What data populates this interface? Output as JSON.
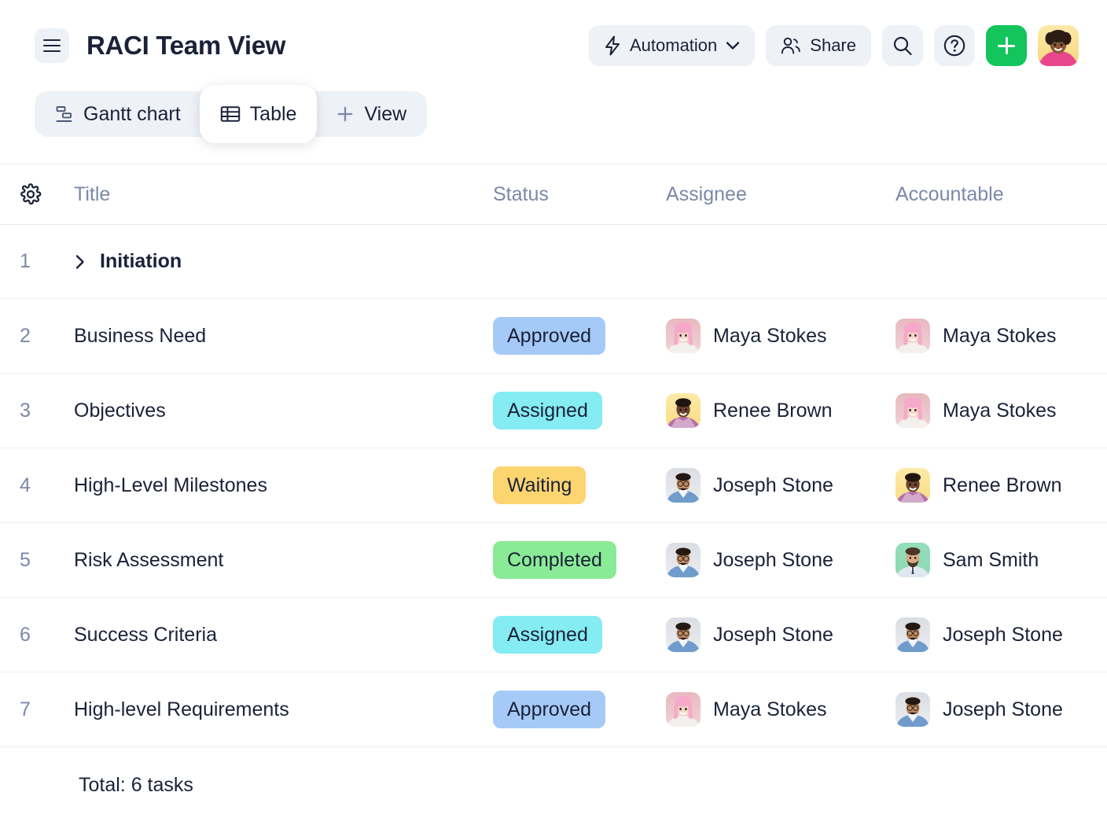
{
  "header": {
    "menu_icon": "hamburger-menu-icon",
    "title": "RACI Team View",
    "automation_label": "Automation",
    "automation_icon": "lightning-bolt-icon",
    "automation_caret": "chevron-down-icon",
    "share_label": "Share",
    "share_icon": "people-icon",
    "search_icon": "search-icon",
    "help_icon": "question-circle-icon",
    "add_icon": "plus-icon",
    "user_avatar": "user-avatar"
  },
  "tabs": [
    {
      "label": "Gantt chart",
      "icon": "gantt-chart-icon",
      "active": false
    },
    {
      "label": "Table",
      "icon": "table-icon",
      "active": true
    },
    {
      "label": "View",
      "icon": "plus-icon",
      "active": false
    }
  ],
  "table": {
    "settings_icon": "gear-icon",
    "columns": [
      "Title",
      "Status",
      "Assignee",
      "Accountable"
    ],
    "group_row": {
      "num": "1",
      "expand_icon": "chevron-right-icon",
      "title": "Initiation"
    },
    "rows": [
      {
        "num": "2",
        "title": "Business Need",
        "status": "Approved",
        "status_color": "#a5caf8",
        "assignee": "Maya Stokes",
        "assignee_avatar": "maya-stokes-avatar",
        "accountable": "Maya Stokes",
        "accountable_avatar": "maya-stokes-avatar"
      },
      {
        "num": "3",
        "title": "Objectives",
        "status": "Assigned",
        "status_color": "#84ecf2",
        "assignee": "Renee Brown",
        "assignee_avatar": "renee-brown-avatar",
        "accountable": "Maya Stokes",
        "accountable_avatar": "maya-stokes-avatar"
      },
      {
        "num": "4",
        "title": "High-Level Milestones",
        "status": "Waiting",
        "status_color": "#fcd570",
        "assignee": "Joseph Stone",
        "assignee_avatar": "joseph-stone-avatar",
        "accountable": "Renee Brown",
        "accountable_avatar": "renee-brown-avatar"
      },
      {
        "num": "5",
        "title": "Risk Assessment",
        "status": "Completed",
        "status_color": "#8aeb96",
        "assignee": "Joseph Stone",
        "assignee_avatar": "joseph-stone-avatar",
        "accountable": "Sam Smith",
        "accountable_avatar": "sam-smith-avatar"
      },
      {
        "num": "6",
        "title": "Success Criteria",
        "status": "Assigned",
        "status_color": "#84ecf2",
        "assignee": "Joseph Stone",
        "assignee_avatar": "joseph-stone-avatar",
        "accountable": "Joseph Stone",
        "accountable_avatar": "joseph-stone-avatar"
      },
      {
        "num": "7",
        "title": "High-level Requirements",
        "status": "Approved",
        "status_color": "#a5caf8",
        "assignee": "Maya Stokes",
        "assignee_avatar": "maya-stokes-avatar",
        "accountable": "Joseph Stone",
        "accountable_avatar": "joseph-stone-avatar"
      }
    ]
  },
  "footer": {
    "total": "Total: 6 tasks"
  },
  "colors": {
    "accent_green": "#13c55c",
    "text_primary": "#1b2138",
    "text_muted": "#7b88a8",
    "chip_bg": "#eef1f6",
    "row_border": "#eceff5"
  }
}
